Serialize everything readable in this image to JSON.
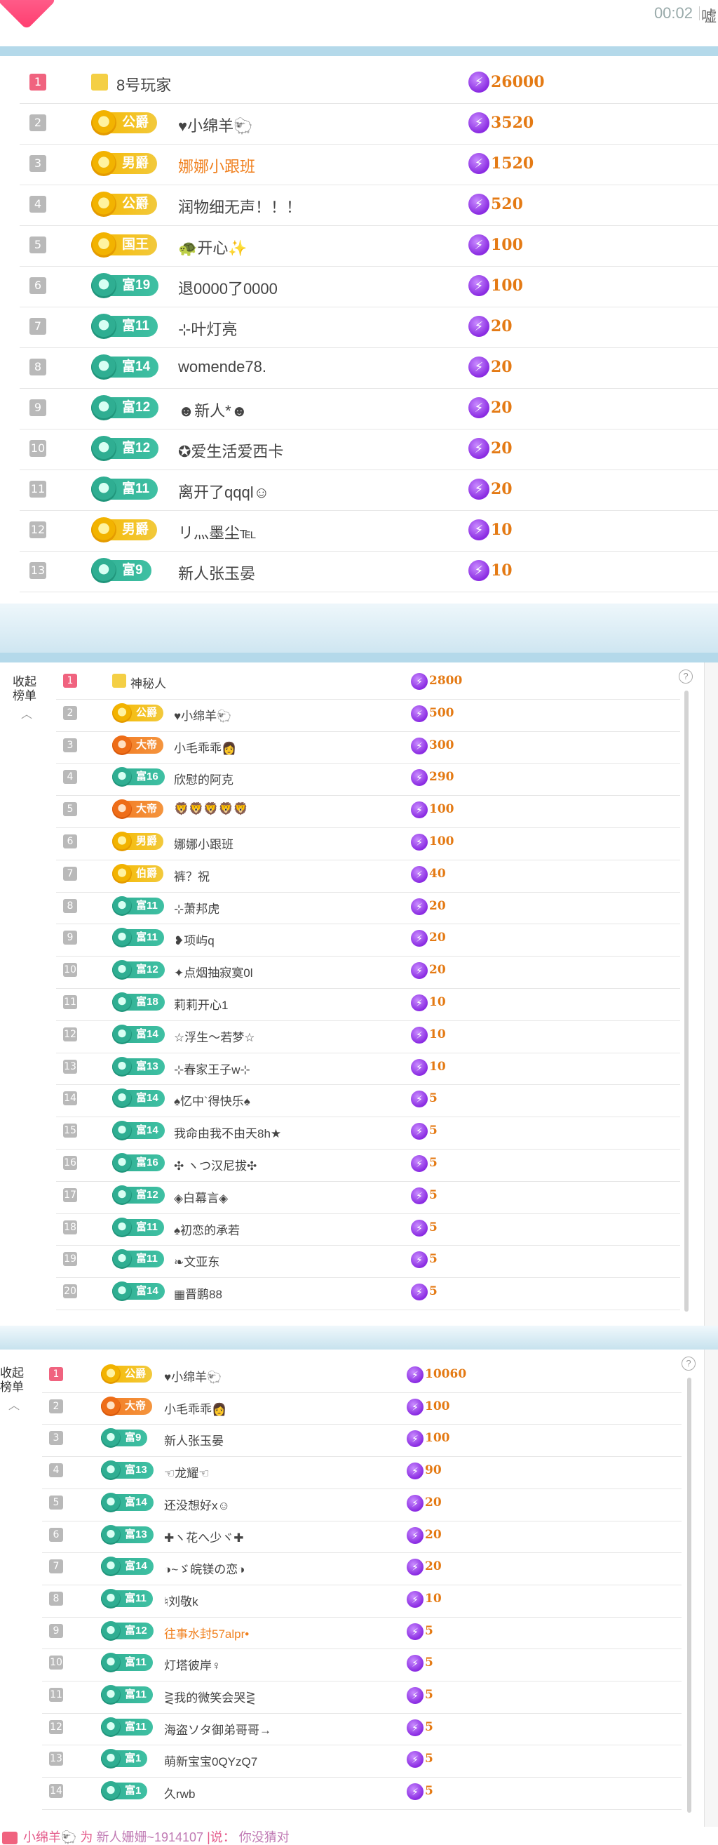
{
  "header": {
    "timer": "00:02",
    "edge_text": "嘘"
  },
  "list1": {
    "rows": [
      {
        "rank": "1",
        "badge": "",
        "name": "8号玩家",
        "amount": "26000",
        "hl": false
      },
      {
        "rank": "2",
        "badge": "公爵",
        "name": "♥小绵羊🐑",
        "amount": "3520",
        "hl": false
      },
      {
        "rank": "3",
        "badge": "男爵",
        "name": "娜娜小跟班",
        "amount": "1520",
        "hl": true
      },
      {
        "rank": "4",
        "badge": "公爵",
        "name": "润物细无声！！！",
        "amount": "520",
        "hl": false
      },
      {
        "rank": "5",
        "badge": "国王",
        "name": "🐢开心✨",
        "amount": "100",
        "hl": false
      },
      {
        "rank": "6",
        "badge": "富19",
        "name": "退0000了0000",
        "amount": "100",
        "hl": false
      },
      {
        "rank": "7",
        "badge": "富11",
        "name": "⊹叶灯亮",
        "amount": "20",
        "hl": false
      },
      {
        "rank": "8",
        "badge": "富14",
        "name": "womende78.",
        "amount": "20",
        "hl": false
      },
      {
        "rank": "9",
        "badge": "富12",
        "name": "☻新人*☻",
        "amount": "20",
        "hl": false
      },
      {
        "rank": "10",
        "badge": "富12",
        "name": "✪爱生活爱西卡",
        "amount": "20",
        "hl": false
      },
      {
        "rank": "11",
        "badge": "富11",
        "name": "离开了qqql☺",
        "amount": "20",
        "hl": false
      },
      {
        "rank": "12",
        "badge": "男爵",
        "name": "リ灬墨尘℡",
        "amount": "10",
        "hl": false
      },
      {
        "rank": "13",
        "badge": "富9",
        "name": "新人张玉晏",
        "amount": "10",
        "hl": false
      }
    ]
  },
  "list2": {
    "side_label": "收起\n榜单",
    "help": "?",
    "rows": [
      {
        "rank": "1",
        "badge": "",
        "name": "神秘人",
        "amount": "2800",
        "hl": false
      },
      {
        "rank": "2",
        "badge": "公爵",
        "name": "♥小绵羊🐑",
        "amount": "500",
        "hl": false
      },
      {
        "rank": "3",
        "badge": "大帝",
        "name": "小毛乖乖👩",
        "amount": "300",
        "hl": false
      },
      {
        "rank": "4",
        "badge": "富16",
        "name": "欣慰的阿克",
        "amount": "290",
        "hl": false
      },
      {
        "rank": "5",
        "badge": "大帝",
        "name": "🦁🦁🦁🦁🦁",
        "amount": "100",
        "hl": false
      },
      {
        "rank": "6",
        "badge": "男爵",
        "name": "娜娜小跟班",
        "amount": "100",
        "hl": false
      },
      {
        "rank": "7",
        "badge": "伯爵",
        "name": "裤？祝",
        "amount": "40",
        "hl": false
      },
      {
        "rank": "8",
        "badge": "富11",
        "name": "⊹萧邦虎",
        "amount": "20",
        "hl": false
      },
      {
        "rank": "9",
        "badge": "富11",
        "name": "❥项屿q",
        "amount": "20",
        "hl": false
      },
      {
        "rank": "10",
        "badge": "富12",
        "name": "✦点烟抽寂寞0l",
        "amount": "20",
        "hl": false
      },
      {
        "rank": "11",
        "badge": "富18",
        "name": "莉莉开心1",
        "amount": "10",
        "hl": false
      },
      {
        "rank": "12",
        "badge": "富14",
        "name": "☆浮生～若梦☆",
        "amount": "10",
        "hl": false
      },
      {
        "rank": "13",
        "badge": "富13",
        "name": "⊹春家王子w⊹",
        "amount": "10",
        "hl": false
      },
      {
        "rank": "14",
        "badge": "富14",
        "name": "♠忆中`得快乐♠",
        "amount": "5",
        "hl": false
      },
      {
        "rank": "15",
        "badge": "富14",
        "name": "我命由我不由天8h★",
        "amount": "5",
        "hl": false
      },
      {
        "rank": "16",
        "badge": "富16",
        "name": "✣ ヽつ汉尼拔✣",
        "amount": "5",
        "hl": false
      },
      {
        "rank": "17",
        "badge": "富12",
        "name": "◈白幕言◈",
        "amount": "5",
        "hl": false
      },
      {
        "rank": "18",
        "badge": "富11",
        "name": "♠初恋的承若",
        "amount": "5",
        "hl": false
      },
      {
        "rank": "19",
        "badge": "富11",
        "name": "❧文亚东",
        "amount": "5",
        "hl": false
      },
      {
        "rank": "20",
        "badge": "富14",
        "name": "▦晋鹏88",
        "amount": "5",
        "hl": false
      }
    ]
  },
  "list3": {
    "side_label": "收起\n榜单",
    "help": "?",
    "rows": [
      {
        "rank": "1",
        "badge": "公爵",
        "name": "♥小绵羊🐑",
        "amount": "10060",
        "hl": false
      },
      {
        "rank": "2",
        "badge": "大帝",
        "name": "小毛乖乖👩",
        "amount": "100",
        "hl": false
      },
      {
        "rank": "3",
        "badge": "富9",
        "name": "新人张玉晏",
        "amount": "100",
        "hl": false
      },
      {
        "rank": "4",
        "badge": "富13",
        "name": "☜龙耀☜",
        "amount": "90",
        "hl": false
      },
      {
        "rank": "5",
        "badge": "富14",
        "name": "还没想好x☺",
        "amount": "20",
        "hl": false
      },
      {
        "rank": "6",
        "badge": "富13",
        "name": "✚ヽ花へ少ヾ✚",
        "amount": "20",
        "hl": false
      },
      {
        "rank": "7",
        "badge": "富14",
        "name": "◑~ゞ皖镁の恋◑",
        "amount": "20",
        "hl": false
      },
      {
        "rank": "8",
        "badge": "富11",
        "name": "♮刘敬k",
        "amount": "10",
        "hl": false
      },
      {
        "rank": "9",
        "badge": "富12",
        "name": "往事水封57alpr•",
        "amount": "5",
        "hl": true
      },
      {
        "rank": "10",
        "badge": "富11",
        "name": "灯塔彼岸♀",
        "amount": "5",
        "hl": false
      },
      {
        "rank": "11",
        "badge": "富11",
        "name": "⋛我的微笑会哭⋛",
        "amount": "5",
        "hl": false
      },
      {
        "rank": "12",
        "badge": "富11",
        "name": "海盗ソタ御弟哥哥→",
        "amount": "5",
        "hl": false
      },
      {
        "rank": "13",
        "badge": "富1",
        "name": "萌新宝宝0QYzQ7",
        "amount": "5",
        "hl": false
      },
      {
        "rank": "14",
        "badge": "富1",
        "name": "久rwb",
        "amount": "5",
        "hl": false
      }
    ]
  },
  "footer": {
    "text1": "小绵羊🐑 为",
    "text2": "新人姗姗~1914107",
    "text3": "|说：",
    "text4": "你没猜对"
  }
}
